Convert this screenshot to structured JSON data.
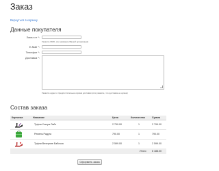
{
  "page": {
    "title": "Заказ",
    "back_link": "Вернуться в корзину"
  },
  "buyer": {
    "heading": "Данные покупателя",
    "fields": [
      {
        "label": "Заказ от *:",
        "hint": "Укажите ФИО, или название Вашей организации"
      },
      {
        "label": "E-Mail *:"
      },
      {
        "label": "Телефон *:"
      },
      {
        "label": "Доставка *:",
        "hint": "Укажите адрес и предпочтительное время доставки (или укажите, что доставка не нужна)"
      }
    ]
  },
  "order": {
    "heading": "Состав заказа",
    "columns": [
      "Картинка",
      "Название",
      "Цена",
      "Количество",
      "Сумма"
    ],
    "items": [
      {
        "name": "Туфли Ультра Лайт",
        "price": "2 799.00",
        "qty": "1",
        "sum": "2 799.00",
        "image": "shoe-high-heel"
      },
      {
        "name": "Ремень Радуга",
        "price": "790.00",
        "qty": "1",
        "sum": "790.00",
        "image": "green-bag"
      },
      {
        "name": "Туфли Вечерние Бабочка",
        "price": "2 599.00",
        "qty": "1",
        "sum": "2 599.00",
        "image": "shoe-butterfly"
      }
    ],
    "total_label": "Итого:",
    "total_value": "6 188.00",
    "submit_label": "Оформить заказ"
  }
}
